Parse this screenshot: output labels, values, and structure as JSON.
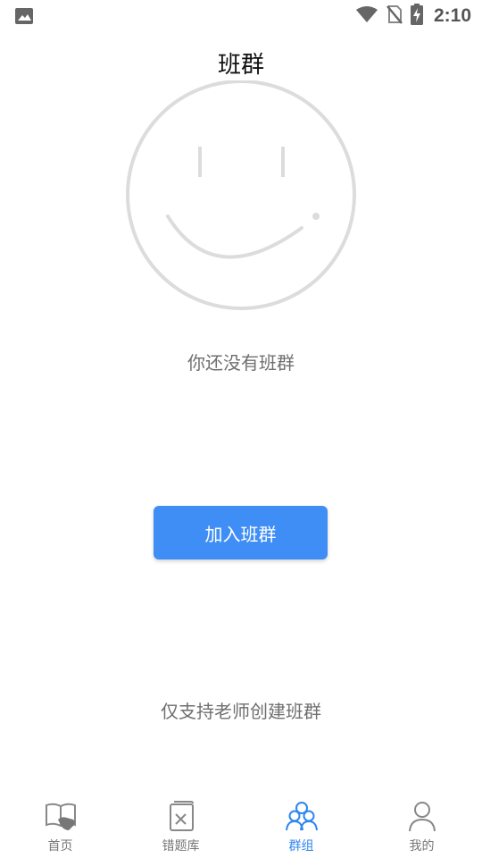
{
  "status_bar": {
    "time": "2:10",
    "icons": [
      "image-icon",
      "wifi-icon",
      "no-sim-icon",
      "battery-charging-icon"
    ]
  },
  "header": {
    "title": "班群"
  },
  "empty_state": {
    "illustration": "smiley-face-icon",
    "message": "你还没有班群"
  },
  "actions": {
    "join_label": "加入班群"
  },
  "note": "仅支持老师创建班群",
  "bottom_nav": {
    "items": [
      {
        "label": "首页",
        "icon": "book-hand-icon",
        "active": false
      },
      {
        "label": "错题库",
        "icon": "error-book-icon",
        "active": false
      },
      {
        "label": "群组",
        "icon": "group-icon",
        "active": true
      },
      {
        "label": "我的",
        "icon": "person-icon",
        "active": false
      }
    ]
  },
  "colors": {
    "accent": "#3f8ef5",
    "active_nav": "#2f86f0",
    "muted_text": "#6f6f6f",
    "illustration": "#dcdcdc"
  }
}
